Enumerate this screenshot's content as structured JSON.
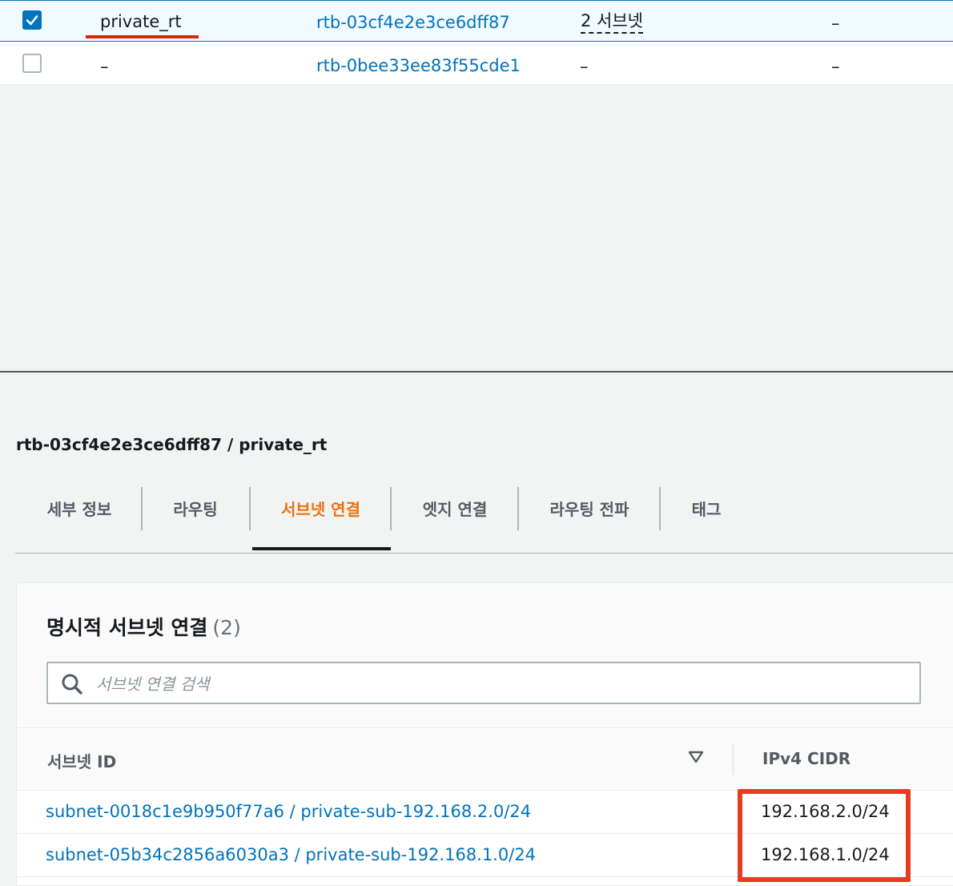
{
  "route_tables": {
    "rows": [
      {
        "selected": true,
        "name": "private_rt",
        "id": "rtb-03cf4e2e3ce6dff87",
        "subnets": "2 서브넷",
        "col4": "–"
      },
      {
        "selected": false,
        "name": "–",
        "id": "rtb-0bee33ee83f55cde1",
        "subnets": "–",
        "col4": "–"
      }
    ]
  },
  "detail": {
    "title": "rtb-03cf4e2e3ce6dff87 / private_rt",
    "tabs": [
      {
        "label": "세부 정보"
      },
      {
        "label": "라우팅"
      },
      {
        "label": "서브넷 연결",
        "active": true
      },
      {
        "label": "엣지 연결"
      },
      {
        "label": "라우팅 전파"
      },
      {
        "label": "태그"
      }
    ]
  },
  "panel": {
    "title": "명시적 서브넷 연결",
    "count": "(2)",
    "search_placeholder": "서브넷 연결 검색",
    "columns": {
      "subnet_id": "서브넷 ID",
      "ipv4_cidr": "IPv4 CIDR"
    },
    "rows": [
      {
        "subnet": "subnet-0018c1e9b950f77a6 / private-sub-192.168.2.0/24",
        "cidr": "192.168.2.0/24"
      },
      {
        "subnet": "subnet-05b34c2856a6030a3 / private-sub-192.168.1.0/24",
        "cidr": "192.168.1.0/24"
      }
    ]
  },
  "colors": {
    "link": "#0073bb",
    "active_tab": "#ec7211",
    "highlight": "#e53c24"
  },
  "icons": [
    "check-icon",
    "search-icon",
    "sort-down-icon"
  ]
}
